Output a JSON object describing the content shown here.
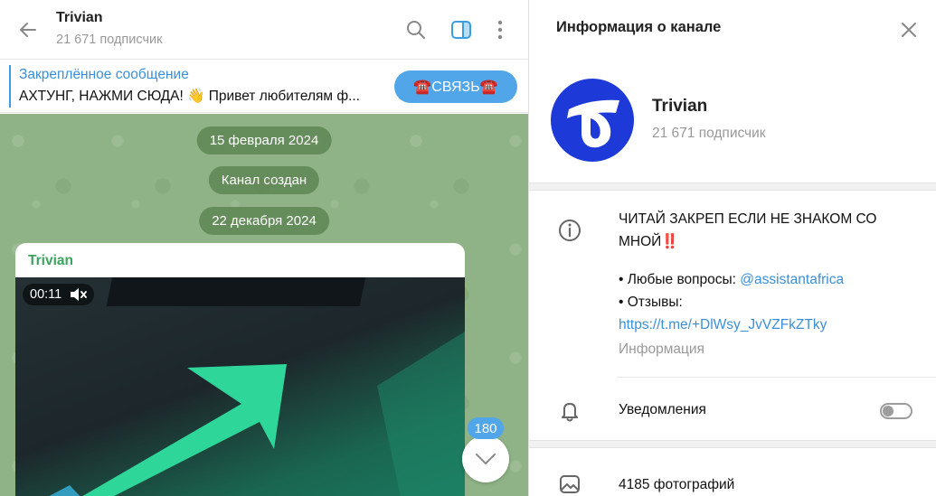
{
  "chat": {
    "title": "Trivian",
    "subscribers": "21 671 подписчик",
    "pinned": {
      "title": "Закреплённое сообщение",
      "text": "АХТУНГ, НАЖМИ СЮДА! 👋 Привет любителям ф...",
      "button": "☎️СВЯЗЬ☎️"
    },
    "dates": [
      "15 февраля 2024",
      "Канал создан",
      "22 декабря 2024"
    ],
    "message": {
      "author": "Trivian",
      "video_time": "00:11"
    },
    "unread_count": "180"
  },
  "info": {
    "panel_title": "Информация о канале",
    "channel_name": "Trivian",
    "subscribers": "21 671 подписчик",
    "description": {
      "line1": "ЧИТАЙ ЗАКРЕП ЕСЛИ НЕ ЗНАКОМ СО",
      "line2": "МНОЙ‼️",
      "questions_prefix": "• Любые вопросы: ",
      "questions_link": "@assistantafrica",
      "reviews_label": "• Отзывы:",
      "reviews_link": "https://t.me/+DlWsy_JvVZFkZTky",
      "caption": "Информация"
    },
    "notifications": {
      "label": "Уведомления",
      "enabled": false
    },
    "photos": "4185 фотографий"
  },
  "colors": {
    "accent": "#3a8fd8",
    "avatar": "#1d3ad8",
    "chat_bg": "#8fb386",
    "author": "#3aa35f"
  },
  "icons": [
    "back-arrow-icon",
    "search-icon",
    "sidebar-toggle-icon",
    "more-vertical-icon",
    "close-icon",
    "info-icon",
    "bell-icon",
    "photo-icon",
    "mute-icon",
    "chevron-down-icon"
  ]
}
